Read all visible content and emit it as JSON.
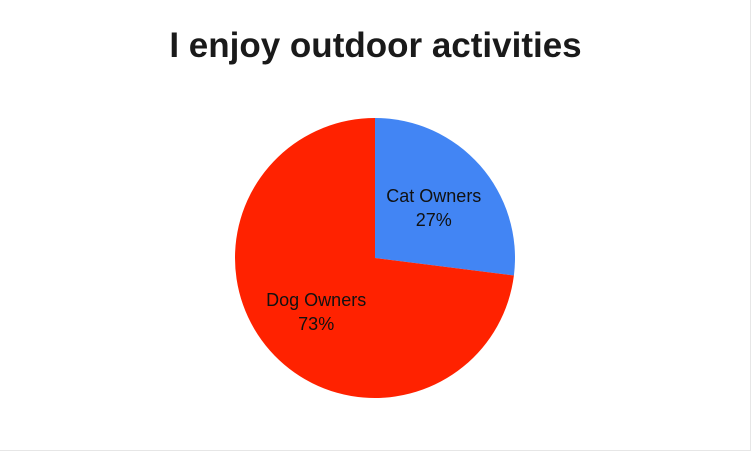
{
  "chart_data": {
    "type": "pie",
    "title": "I enjoy outdoor activities",
    "categories": [
      "Cat Owners",
      "Dog Owners"
    ],
    "values": [
      27,
      73
    ],
    "value_labels": [
      "27%",
      "73%"
    ],
    "colors": [
      "#4285f4",
      "#ff2200"
    ],
    "start": "12 o'clock",
    "direction": "clockwise",
    "legend": "none"
  }
}
